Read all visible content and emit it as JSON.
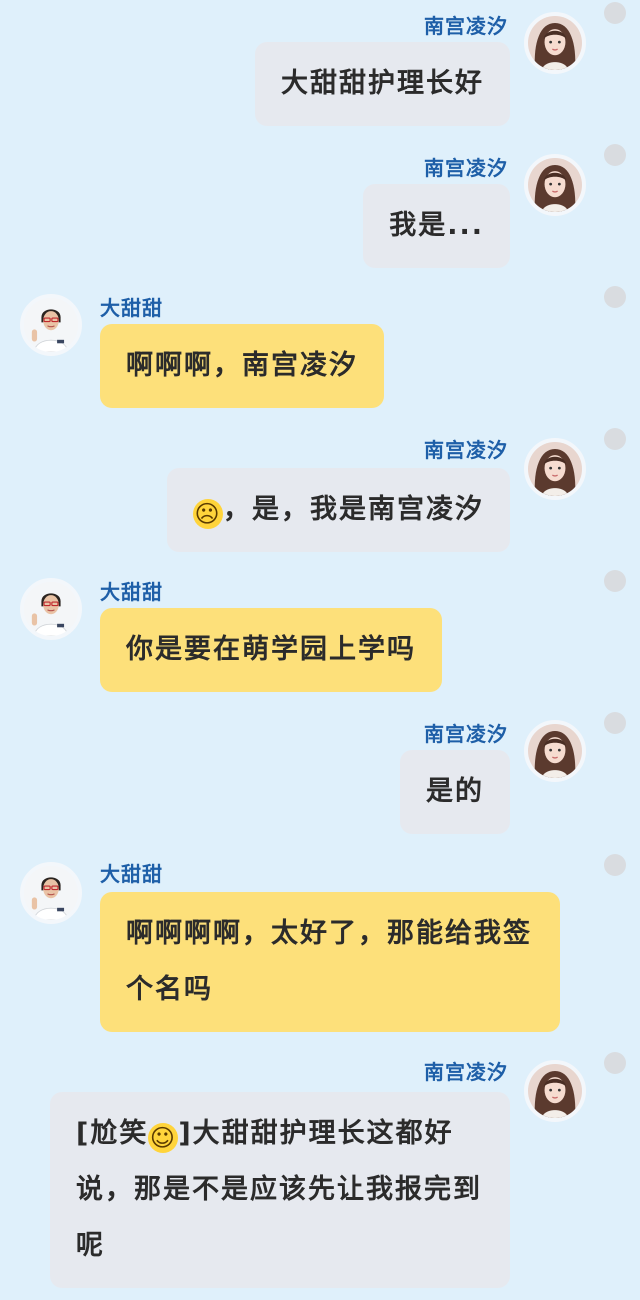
{
  "users": {
    "self_name": "南宫凌汐",
    "other_name": "大甜甜"
  },
  "messages": [
    {
      "sender": "self",
      "text": "大甜甜护理长好"
    },
    {
      "sender": "self",
      "text": "我是..."
    },
    {
      "sender": "other",
      "text": "啊啊啊，南宫凌汐"
    },
    {
      "sender": "self",
      "emoji": "crying-face",
      "text": "，是，我是南宫凌汐"
    },
    {
      "sender": "other",
      "text": "你是要在萌学园上学吗"
    },
    {
      "sender": "self",
      "text": "是的"
    },
    {
      "sender": "other",
      "text": "啊啊啊啊，太好了，那能给我签个名吗"
    },
    {
      "sender": "self",
      "prefix": "[尬笑",
      "emoji": "grinning-sweat-face",
      "text": "]大甜甜护理长这都好说，那是不是应该先让我报完到呢"
    }
  ],
  "colors": {
    "background": "#dff0fb",
    "self_bubble": "#e6e9ef",
    "other_bubble": "#fde07a",
    "name_text": "#1e5fa8"
  }
}
